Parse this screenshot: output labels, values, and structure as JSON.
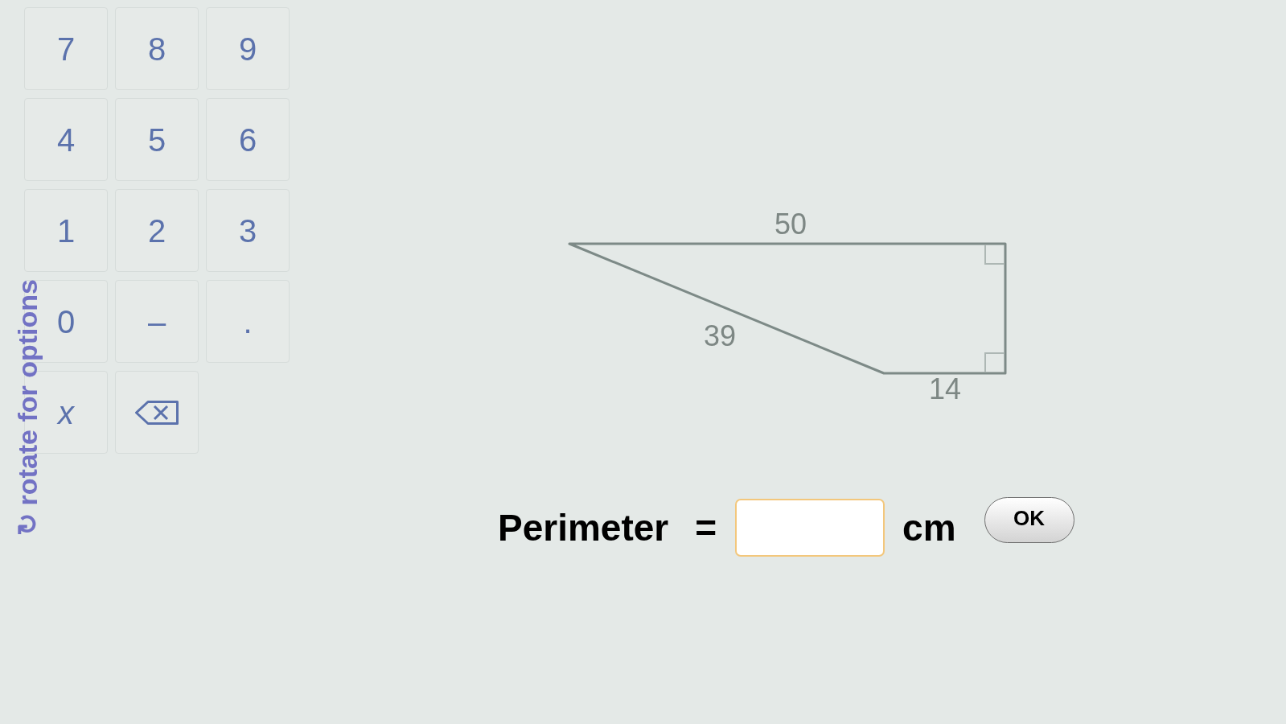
{
  "keypad": {
    "keys": [
      {
        "kind": "digit",
        "label": "7"
      },
      {
        "kind": "digit",
        "label": "8"
      },
      {
        "kind": "digit",
        "label": "9"
      },
      {
        "kind": "digit",
        "label": "4"
      },
      {
        "kind": "digit",
        "label": "5"
      },
      {
        "kind": "digit",
        "label": "6"
      },
      {
        "kind": "digit",
        "label": "1"
      },
      {
        "kind": "digit",
        "label": "2"
      },
      {
        "kind": "digit",
        "label": "3"
      },
      {
        "kind": "digit",
        "label": "0"
      },
      {
        "kind": "symbol",
        "label": "–"
      },
      {
        "kind": "symbol",
        "label": "."
      },
      {
        "kind": "variable",
        "label": "x"
      },
      {
        "kind": "backspace"
      }
    ]
  },
  "rotate_hint": "↻ rotate for options",
  "diagram": {
    "side_labels": [
      {
        "kind": "top",
        "label": "50"
      },
      {
        "kind": "slant",
        "label": "39"
      },
      {
        "kind": "bottom",
        "label": "14"
      }
    ]
  },
  "answer": {
    "label": "Perimeter",
    "operator": "=",
    "field": {
      "focused": true
    },
    "unit": "cm",
    "button": "OK"
  }
}
